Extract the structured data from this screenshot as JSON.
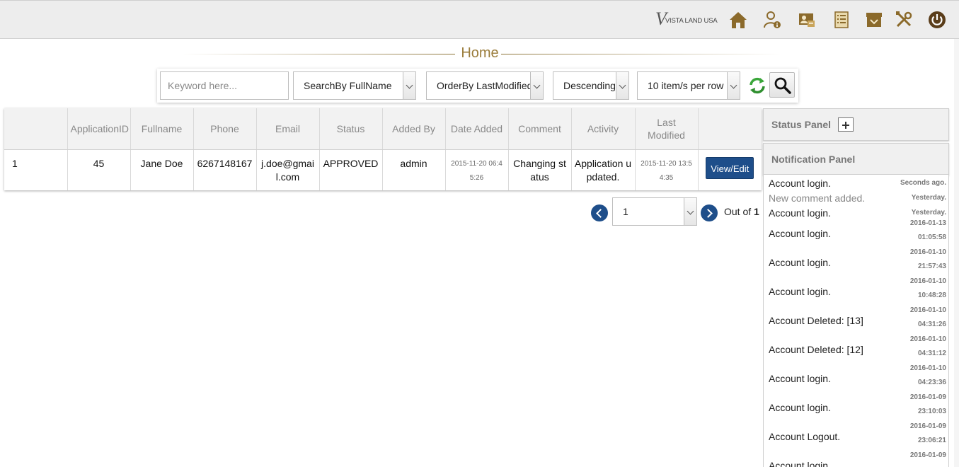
{
  "header": {
    "logo_text": "VISTA LAND USA",
    "logo_letter": "V",
    "nav_icons": [
      "home-icon",
      "user-info-icon",
      "id-card-icon",
      "list-icon",
      "archive-box-icon",
      "tools-icon",
      "power-icon"
    ],
    "icon_color": "#8b6a2b"
  },
  "page": {
    "title": "Home"
  },
  "toolbar": {
    "keyword_placeholder": "Keyword here...",
    "search_by": "SearchBy FullName",
    "order_by": "OrderBy LastModified",
    "sort_direction": "Descending",
    "per_page": "10 item/s per row"
  },
  "table": {
    "headers": [
      "",
      "ApplicationID",
      "Fullname",
      "Phone",
      "Email",
      "Status",
      "Added By",
      "Date Added",
      "Comment",
      "Activity",
      "Last Modified",
      ""
    ],
    "rows": [
      {
        "index": "1",
        "application_id": "45",
        "fullname": "Jane Doe",
        "phone": "6267148167",
        "email": "j.doe@gmail.com",
        "status": "APPROVED",
        "added_by": "admin",
        "date_added": "2015-11-20 06:45:26",
        "comment": "Changing status",
        "activity": "Application updated.",
        "last_modified": "2015-11-20 13:54:35",
        "action_label": "View/Edit"
      }
    ]
  },
  "pagination": {
    "current": "1",
    "out_of_label": "Out of",
    "total": "1"
  },
  "panels": {
    "status_title": "Status Panel",
    "notification_title": "Notification Panel"
  },
  "notifications": [
    {
      "message": "Account login.",
      "when": "Seconds ago.",
      "muted": false
    },
    {
      "message": "New comment added.",
      "when": "Yesterday.",
      "muted": true
    },
    {
      "message": "Account login.",
      "when": "Yesterday.",
      "muted": false
    },
    {
      "message": "Account login.",
      "date": "2016-01-13",
      "time": "01:05:58"
    },
    {
      "message": "Account login.",
      "date": "2016-01-10",
      "time": "21:57:43"
    },
    {
      "message": "Account login.",
      "date": "2016-01-10",
      "time": "10:48:28"
    },
    {
      "message": "Account Deleted: [13]",
      "date": "2016-01-10",
      "time": "04:31:26"
    },
    {
      "message": "Account Deleted: [12]",
      "date": "2016-01-10",
      "time": "04:31:12"
    },
    {
      "message": "Account login.",
      "date": "2016-01-10",
      "time": "04:23:36"
    },
    {
      "message": "Account login.",
      "date": "2016-01-09",
      "time": "23:10:03"
    },
    {
      "message": "Account Logout.",
      "date": "2016-01-09",
      "time": "23:06:21"
    },
    {
      "message": "Account login.",
      "date": "2016-01-09",
      "time": ""
    }
  ]
}
